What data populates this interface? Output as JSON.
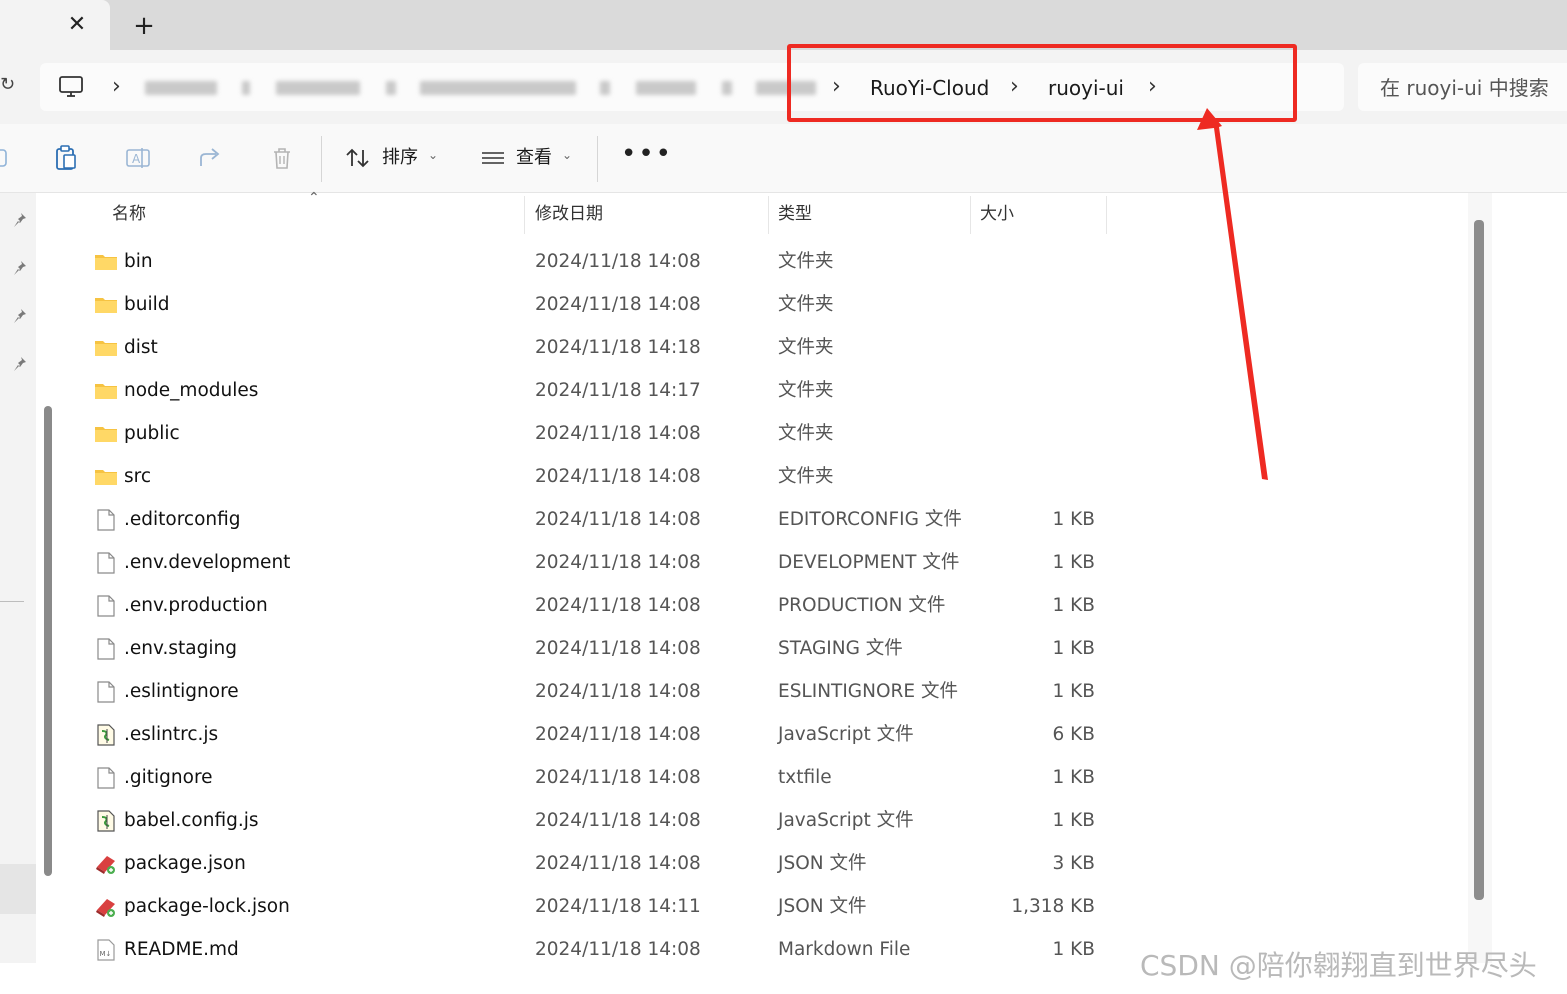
{
  "tabbar": {
    "close_glyph": "✕",
    "new_tab_glyph": "+"
  },
  "address": {
    "separator": "›",
    "crumbs": [
      "RuoYi-Cloud",
      "ruoyi-ui"
    ]
  },
  "search": {
    "placeholder": "在 ruoyi-ui 中搜索"
  },
  "toolbar": {
    "sort_label": "排序",
    "view_label": "查看",
    "more_glyph": "•••",
    "caret": "⌄"
  },
  "columns": {
    "name": "名称",
    "date": "修改日期",
    "type": "类型",
    "size": "大小"
  },
  "files": [
    {
      "name": "bin",
      "date": "2024/11/18 14:08",
      "type": "文件夹",
      "size": "",
      "kind": "folder"
    },
    {
      "name": "build",
      "date": "2024/11/18 14:08",
      "type": "文件夹",
      "size": "",
      "kind": "folder"
    },
    {
      "name": "dist",
      "date": "2024/11/18 14:18",
      "type": "文件夹",
      "size": "",
      "kind": "folder"
    },
    {
      "name": "node_modules",
      "date": "2024/11/18 14:17",
      "type": "文件夹",
      "size": "",
      "kind": "folder"
    },
    {
      "name": "public",
      "date": "2024/11/18 14:08",
      "type": "文件夹",
      "size": "",
      "kind": "folder"
    },
    {
      "name": "src",
      "date": "2024/11/18 14:08",
      "type": "文件夹",
      "size": "",
      "kind": "folder"
    },
    {
      "name": ".editorconfig",
      "date": "2024/11/18 14:08",
      "type": "EDITORCONFIG 文件",
      "size": "1 KB",
      "kind": "file"
    },
    {
      "name": ".env.development",
      "date": "2024/11/18 14:08",
      "type": "DEVELOPMENT 文件",
      "size": "1 KB",
      "kind": "file"
    },
    {
      "name": ".env.production",
      "date": "2024/11/18 14:08",
      "type": "PRODUCTION 文件",
      "size": "1 KB",
      "kind": "file"
    },
    {
      "name": ".env.staging",
      "date": "2024/11/18 14:08",
      "type": "STAGING 文件",
      "size": "1 KB",
      "kind": "file"
    },
    {
      "name": ".eslintignore",
      "date": "2024/11/18 14:08",
      "type": "ESLINTIGNORE 文件",
      "size": "1 KB",
      "kind": "file"
    },
    {
      "name": ".eslintrc.js",
      "date": "2024/11/18 14:08",
      "type": "JavaScript 文件",
      "size": "6 KB",
      "kind": "js"
    },
    {
      "name": ".gitignore",
      "date": "2024/11/18 14:08",
      "type": "txtfile",
      "size": "1 KB",
      "kind": "file"
    },
    {
      "name": "babel.config.js",
      "date": "2024/11/18 14:08",
      "type": "JavaScript 文件",
      "size": "1 KB",
      "kind": "js"
    },
    {
      "name": "package.json",
      "date": "2024/11/18 14:08",
      "type": "JSON 文件",
      "size": "3 KB",
      "kind": "json"
    },
    {
      "name": "package-lock.json",
      "date": "2024/11/18 14:11",
      "type": "JSON 文件",
      "size": "1,318 KB",
      "kind": "json"
    },
    {
      "name": "README.md",
      "date": "2024/11/18 14:08",
      "type": "Markdown File",
      "size": "1 KB",
      "kind": "md"
    }
  ],
  "watermark": "CSDN @陪你翱翔直到世界尽头",
  "colors": {
    "highlight": "#ee2a22",
    "folder": "#f6c342"
  }
}
